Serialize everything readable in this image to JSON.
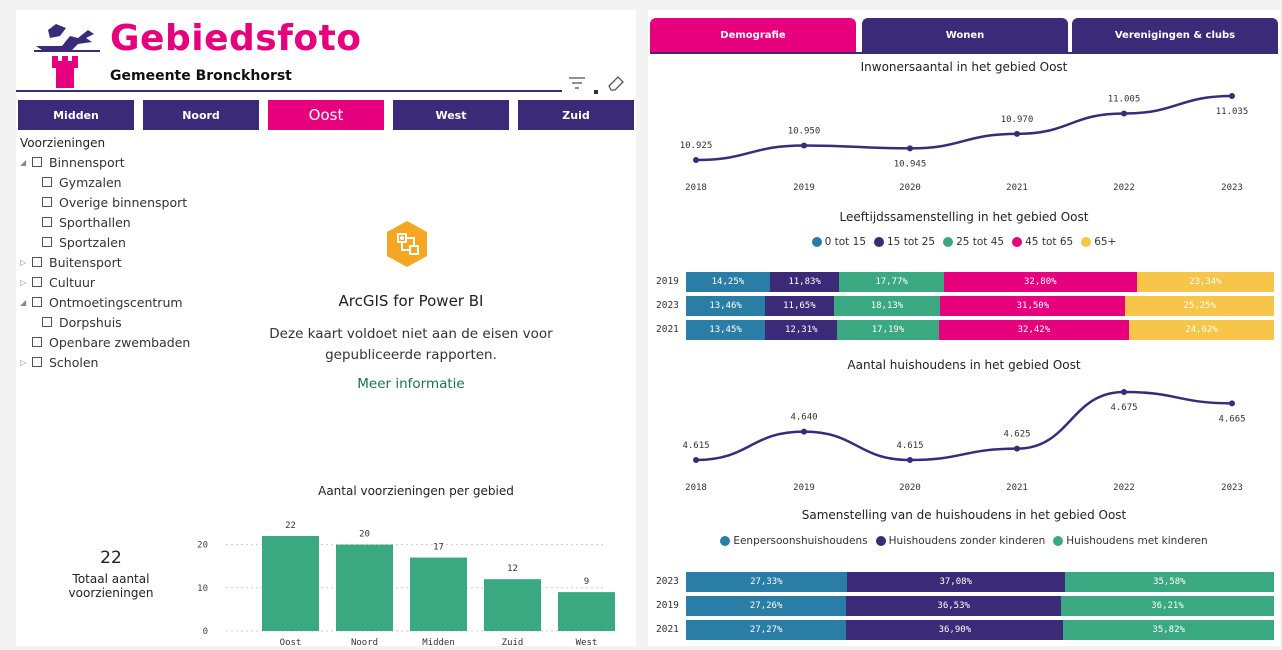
{
  "header": {
    "title": "Gebiedsfoto",
    "subtitle": "Gemeente Bronckhorst"
  },
  "areas": [
    {
      "label": "Midden",
      "active": false
    },
    {
      "label": "Noord",
      "active": false
    },
    {
      "label": "Oost",
      "active": true
    },
    {
      "label": "West",
      "active": false
    },
    {
      "label": "Zuid",
      "active": false
    }
  ],
  "tree": {
    "header": "Voorzieningen",
    "nodes": [
      {
        "label": "Binnensport",
        "level": 1,
        "caret": "expanded"
      },
      {
        "label": "Gymzalen",
        "level": 2,
        "caret": "none"
      },
      {
        "label": "Overige binnensport",
        "level": 2,
        "caret": "none"
      },
      {
        "label": "Sporthallen",
        "level": 2,
        "caret": "none"
      },
      {
        "label": "Sportzalen",
        "level": 2,
        "caret": "none"
      },
      {
        "label": "Buitensport",
        "level": 1,
        "caret": "collapsed"
      },
      {
        "label": "Cultuur",
        "level": 1,
        "caret": "collapsed"
      },
      {
        "label": "Ontmoetingscentrum",
        "level": 1,
        "caret": "expanded"
      },
      {
        "label": "Dorpshuis",
        "level": 2,
        "caret": "none"
      },
      {
        "label": "Openbare zwembaden",
        "level": 1,
        "caret": "none"
      },
      {
        "label": "Scholen",
        "level": 1,
        "caret": "collapsed"
      }
    ]
  },
  "map": {
    "title": "ArcGIS for Power BI",
    "message_line1": "Deze kaart voldoet niet aan de eisen voor",
    "message_line2": "gepubliceerde rapporten.",
    "link": "Meer informatie",
    "icon": "arcgis-map-icon"
  },
  "kpi": {
    "value": "22",
    "label_line1": "Totaal aantal",
    "label_line2": "voorzieningen"
  },
  "tabs": [
    {
      "label": "Demografie",
      "active": true
    },
    {
      "label": "Wonen",
      "active": false
    },
    {
      "label": "Verenigingen & clubs",
      "active": false
    }
  ],
  "colors": {
    "brand_pink": "#e6007e",
    "brand_purple": "#3b2a78",
    "age": [
      "#2a7ea6",
      "#3b2a78",
      "#3aa982",
      "#e6007e",
      "#f7c548"
    ],
    "household": [
      "#2a7ea6",
      "#3b2a78",
      "#3aa982"
    ],
    "bar": "#3aa982",
    "line": "#3b2a78"
  },
  "chart_data": [
    {
      "type": "bar",
      "title": "Aantal voorzieningen per gebied",
      "categories": [
        "Oost",
        "Noord",
        "Midden",
        "Zuid",
        "West"
      ],
      "values": [
        22,
        20,
        17,
        12,
        9
      ],
      "value_labels": [
        "22",
        "20",
        "17",
        "12",
        "9"
      ],
      "yticks": [
        "0",
        "10",
        "20"
      ],
      "ylim": [
        0,
        25
      ]
    },
    {
      "type": "line",
      "title": "Inwonersaantal in het gebied Oost",
      "x": [
        "2018",
        "2019",
        "2020",
        "2021",
        "2022",
        "2023"
      ],
      "values": [
        10925,
        10950,
        10945,
        10970,
        11005,
        11035
      ],
      "value_labels": [
        "10.925",
        "10.950",
        "10.945",
        "10.970",
        "11.005",
        "11.035"
      ],
      "label_pos": [
        "above",
        "above",
        "below",
        "above",
        "above",
        "below"
      ]
    },
    {
      "type": "bar",
      "orientation": "horizontal-stacked-100",
      "title": "Leeftijdssamenstelling in het gebied Oost",
      "legend": [
        "0 tot 15",
        "15 tot 25",
        "25 tot 45",
        "45 tot 65",
        "65+"
      ],
      "categories": [
        "2019",
        "2023",
        "2021"
      ],
      "series_values": [
        [
          14.25,
          11.83,
          17.77,
          32.8,
          23.34
        ],
        [
          13.46,
          11.65,
          18.13,
          31.5,
          25.25
        ],
        [
          13.45,
          12.31,
          17.19,
          32.42,
          24.62
        ]
      ],
      "value_labels": [
        [
          "14,25%",
          "11,83%",
          "17,77%",
          "32,80%",
          "23,34%"
        ],
        [
          "13,46%",
          "11,65%",
          "18,13%",
          "31,50%",
          "25,25%"
        ],
        [
          "13,45%",
          "12,31%",
          "17,19%",
          "32,42%",
          "24,62%"
        ]
      ]
    },
    {
      "type": "line",
      "title": "Aantal huishoudens in het gebied Oost",
      "x": [
        "2018",
        "2019",
        "2020",
        "2021",
        "2022",
        "2023"
      ],
      "values": [
        4615,
        4640,
        4615,
        4625,
        4675,
        4665
      ],
      "value_labels": [
        "4.615",
        "4.640",
        "4.615",
        "4.625",
        "4.675",
        "4.665"
      ],
      "label_pos": [
        "above",
        "above",
        "above",
        "above",
        "below",
        "below"
      ]
    },
    {
      "type": "bar",
      "orientation": "horizontal-stacked-100",
      "title": "Samenstelling van de huishoudens in het gebied Oost",
      "legend": [
        "Eenpersoonshuishoudens",
        "Huishoudens zonder kinderen",
        "Huishoudens met kinderen"
      ],
      "categories": [
        "2023",
        "2019",
        "2021"
      ],
      "series_values": [
        [
          27.33,
          37.08,
          35.58
        ],
        [
          27.26,
          36.53,
          36.21
        ],
        [
          27.27,
          36.9,
          35.82
        ]
      ],
      "value_labels": [
        [
          "27,33%",
          "37,08%",
          "35,58%"
        ],
        [
          "27,26%",
          "36,53%",
          "36,21%"
        ],
        [
          "27,27%",
          "36,90%",
          "35,82%"
        ]
      ]
    }
  ]
}
